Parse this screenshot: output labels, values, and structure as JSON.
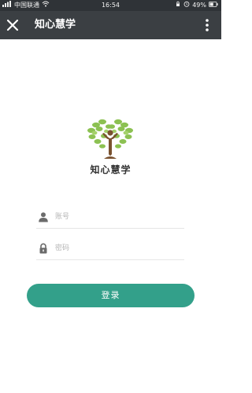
{
  "status_bar": {
    "carrier": "中国联通",
    "time": "16:54",
    "battery": "49%"
  },
  "titlebar": {
    "title": "知心慧学",
    "close_icon": "close-icon",
    "more_icon": "more-vertical-icon"
  },
  "logo": {
    "name": "知心慧学",
    "icon": "heart-tree-logo",
    "leaf_color": "#8cc152",
    "trunk_color": "#7a5230"
  },
  "form": {
    "account_placeholder": "账号",
    "account_icon": "user-icon",
    "password_placeholder": "密码",
    "password_icon": "lock-icon",
    "login_label": "登录",
    "accent_color": "#33a08a"
  }
}
